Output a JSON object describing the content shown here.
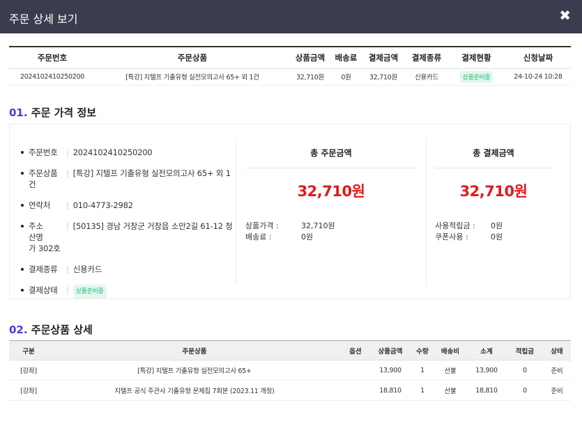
{
  "header": {
    "title": "주문 상세 보기",
    "close_symbol": "✖"
  },
  "order_summary": {
    "columns": [
      "주문번호",
      "주문상품",
      "상품금액",
      "배송료",
      "결제금액",
      "결제종류",
      "결제현황",
      "신청날짜"
    ],
    "row": {
      "order_no": "2024102410250200",
      "product": "[특강] 지텔프 기출유형 실전모의고사 65+ 외 1건",
      "product_price": "32,710원",
      "shipping": "0원",
      "payment_amount": "32,710원",
      "payment_type": "신용카드",
      "status": "상품준비중",
      "date": "24-10-24 10:28"
    }
  },
  "section1": {
    "num": "01.",
    "title": " 주문 가격 정보"
  },
  "info": {
    "order_no_label": "주문번호",
    "order_no": "2024102410250200",
    "product_label": "주문상품",
    "product": "[특강] 지텔프 기출유형 실전모의고사 65+ 외 1건",
    "phone_label": "연락처",
    "phone": "010-4773-2982",
    "address_label": "주소",
    "address_line1": "[50135] 경남 거창군 거창읍 소만2길 61-12 청산명",
    "address_line2": "가 302호",
    "pay_type_label": "결제종류",
    "pay_type": "신용카드",
    "pay_status_label": "결제상태",
    "pay_status": "상품준비중"
  },
  "total_order": {
    "heading": "총 주문금액",
    "amount": "32,710원",
    "product_price_label": "상품가격 :",
    "product_price": "32,710원",
    "shipping_label": "배송료 :",
    "shipping": "0원"
  },
  "total_payment": {
    "heading": "총 결제금액",
    "amount": "32,710원",
    "points_label": "사용적립금 :",
    "points": "0원",
    "coupon_label": "쿠폰사용 :",
    "coupon": "0원"
  },
  "section2": {
    "num": "02.",
    "title": " 주문상품 상세"
  },
  "items_table": {
    "columns": [
      "구분",
      "주문상품",
      "옵션",
      "상품금액",
      "수량",
      "배송비",
      "소계",
      "적립금",
      "상태"
    ],
    "rows": [
      [
        "[강좌]",
        "[특강] 지텔프 기출유형 실전모의고사 65+",
        "",
        "13,900",
        "1",
        "선불",
        "13,900",
        "0",
        "준비"
      ],
      [
        "[강좌]",
        "지텔프 공식 주관사 기출유형 문제집 7회분 (2023.11 개정)",
        "",
        "18,810",
        "1",
        "선불",
        "18,810",
        "0",
        "준비"
      ]
    ]
  },
  "colors": {
    "header_bg": "#3b3d4e",
    "accent_purple": "#5b32d6",
    "price_red": "#e11a1a",
    "status_green": "#27b77a"
  }
}
